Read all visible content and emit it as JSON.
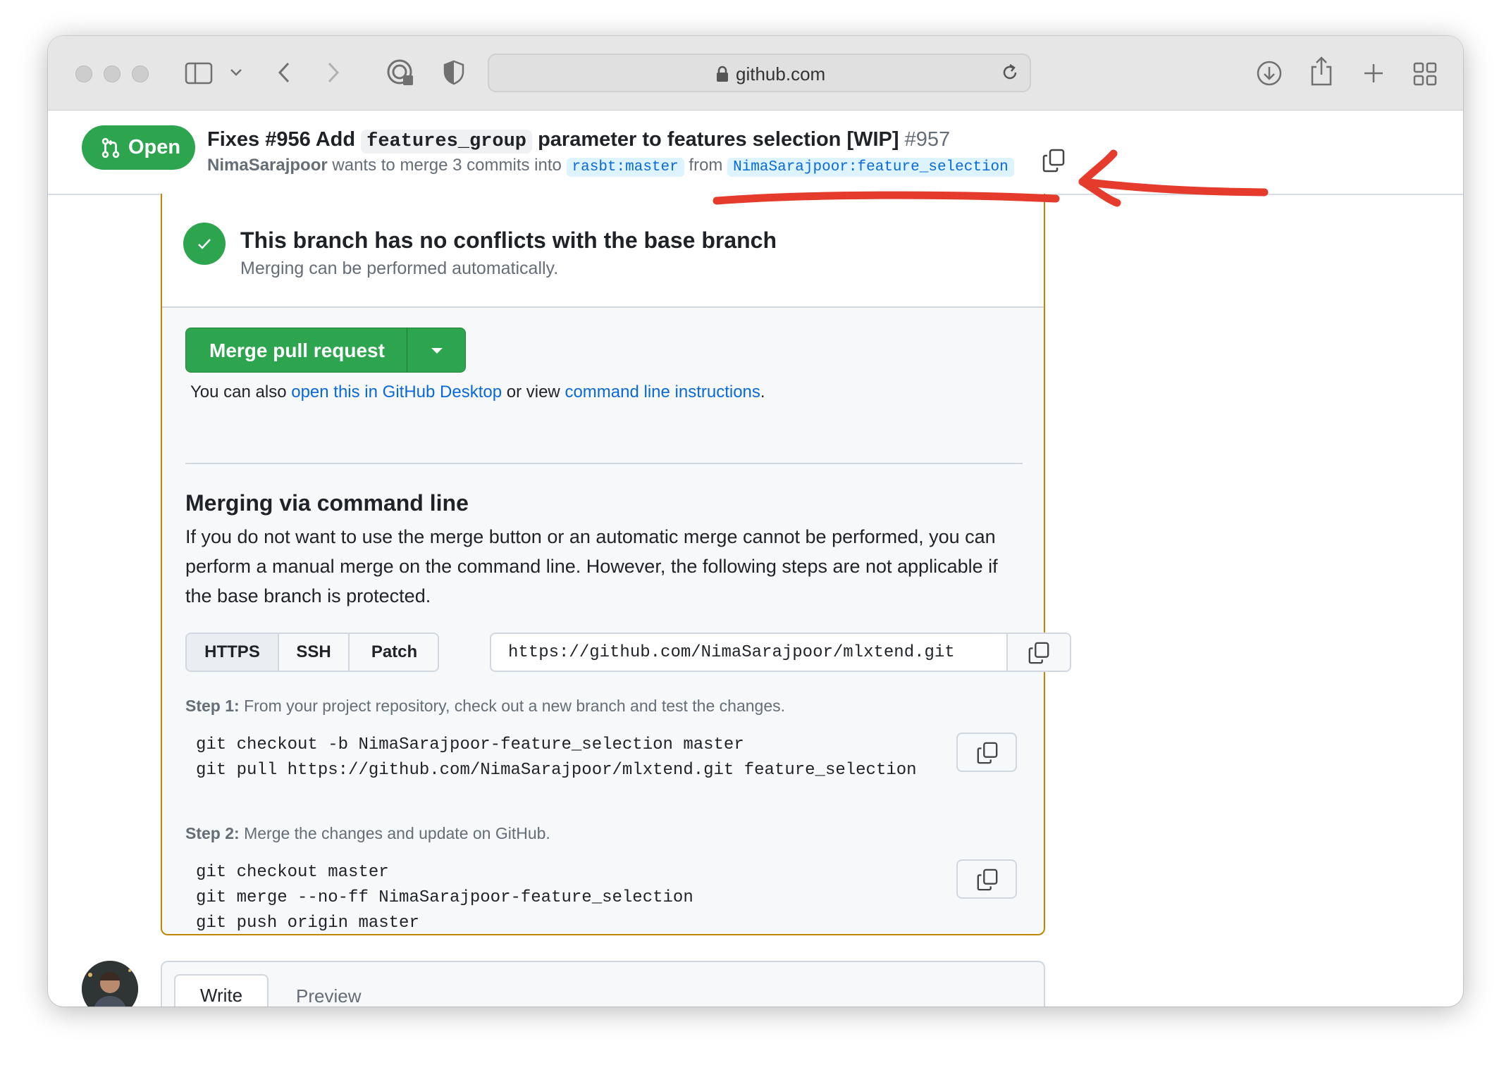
{
  "browser": {
    "url": "github.com",
    "icons": [
      "sidebar-icon",
      "chevron-down-icon",
      "back-icon",
      "forward-icon",
      "privacy-report-icon",
      "shield-icon",
      "lock-icon",
      "reload-icon",
      "download-icon",
      "share-icon",
      "new-tab-icon",
      "tab-overview-icon"
    ]
  },
  "pr": {
    "state": "Open",
    "title_prefix": "Fixes #956 Add",
    "title_code": "features_group",
    "title_suffix": "parameter to features selection [WIP]",
    "number": "#957",
    "author": "NimaSarajpoor",
    "merge_text": "wants to merge 3 commits into",
    "base_branch": "rasbt:master",
    "from_text": "from",
    "head_branch": "NimaSarajpoor:feature_selection"
  },
  "merge": {
    "status_title": "This branch has no conflicts with the base branch",
    "status_sub": "Merging can be performed automatically.",
    "button_label": "Merge pull request",
    "also_prefix": "You can also",
    "desktop_link": "open this in GitHub Desktop",
    "also_middle": "or view",
    "cli_link": "command line instructions",
    "also_suffix": "."
  },
  "cli": {
    "title": "Merging via command line",
    "description": "If you do not want to use the merge button or an automatic merge cannot be performed, you can perform a manual merge on the command line. However, the following steps are not applicable if the base branch is protected.",
    "protocols": [
      "HTTPS",
      "SSH",
      "Patch"
    ],
    "selected_protocol": "HTTPS",
    "clone_url": "https://github.com/NimaSarajpoor/mlxtend.git",
    "step1_label": "Step 1:",
    "step1_text": "From your project repository, check out a new branch and test the changes.",
    "step1_code": [
      "git checkout -b NimaSarajpoor-feature_selection master",
      "git pull https://github.com/NimaSarajpoor/mlxtend.git feature_selection"
    ],
    "step2_label": "Step 2:",
    "step2_text": "Merge the changes and update on GitHub.",
    "step2_code": [
      "git checkout master",
      "git merge --no-ff NimaSarajpoor-feature_selection",
      "git push origin master"
    ]
  },
  "comment": {
    "tabs": [
      "Write",
      "Preview"
    ]
  },
  "colors": {
    "accent_green": "#2da44e",
    "link_blue": "#0969da",
    "annotation_red": "#e53b2c",
    "merge_border": "#bf8700"
  }
}
